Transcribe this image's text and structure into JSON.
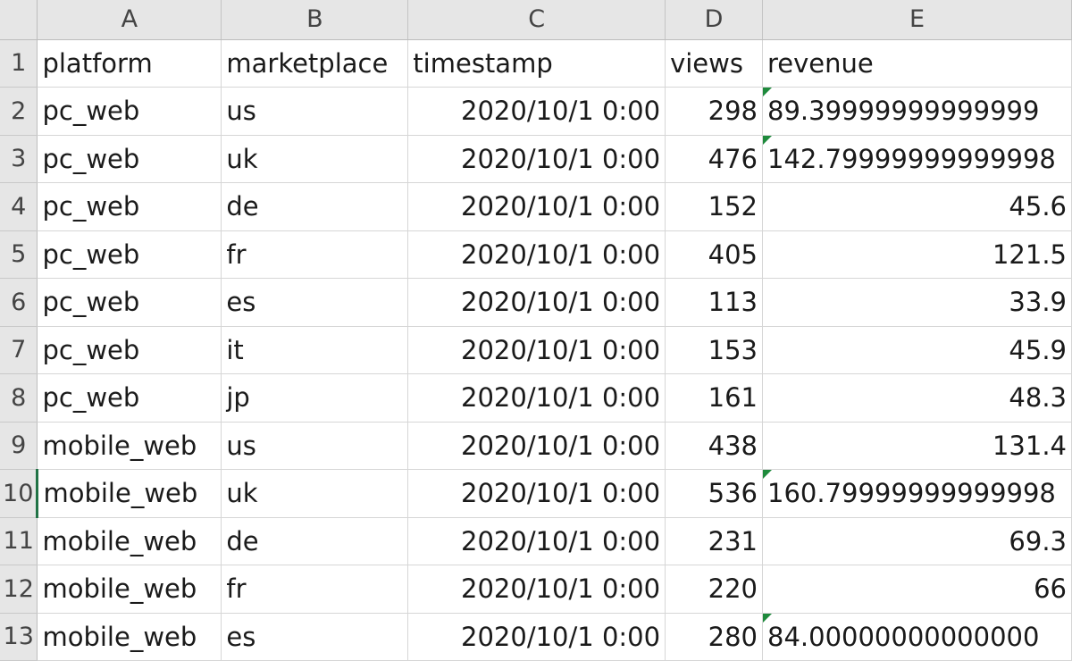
{
  "columns": [
    "A",
    "B",
    "C",
    "D",
    "E"
  ],
  "rows": [
    {
      "n": "1",
      "cells": [
        "platform",
        "marketplace",
        "timestamp",
        "views",
        "revenue"
      ],
      "kind": "header"
    },
    {
      "n": "2",
      "cells": [
        "pc_web",
        "us",
        "2020/10/1 0:00",
        "298",
        "89.39999999999999"
      ],
      "revenue_text": true
    },
    {
      "n": "3",
      "cells": [
        "pc_web",
        "uk",
        "2020/10/1 0:00",
        "476",
        "142.79999999999998"
      ],
      "revenue_text": true
    },
    {
      "n": "4",
      "cells": [
        "pc_web",
        "de",
        "2020/10/1 0:00",
        "152",
        "45.6"
      ]
    },
    {
      "n": "5",
      "cells": [
        "pc_web",
        "fr",
        "2020/10/1 0:00",
        "405",
        "121.5"
      ]
    },
    {
      "n": "6",
      "cells": [
        "pc_web",
        "es",
        "2020/10/1 0:00",
        "113",
        "33.9"
      ]
    },
    {
      "n": "7",
      "cells": [
        "pc_web",
        "it",
        "2020/10/1 0:00",
        "153",
        "45.9"
      ]
    },
    {
      "n": "8",
      "cells": [
        "pc_web",
        "jp",
        "2020/10/1 0:00",
        "161",
        "48.3"
      ]
    },
    {
      "n": "9",
      "cells": [
        "mobile_web",
        "us",
        "2020/10/1 0:00",
        "438",
        "131.4"
      ]
    },
    {
      "n": "10",
      "cells": [
        "mobile_web",
        "uk",
        "2020/10/1 0:00",
        "536",
        "160.79999999999998"
      ],
      "revenue_text": true,
      "active": true
    },
    {
      "n": "11",
      "cells": [
        "mobile_web",
        "de",
        "2020/10/1 0:00",
        "231",
        "69.3"
      ]
    },
    {
      "n": "12",
      "cells": [
        "mobile_web",
        "fr",
        "2020/10/1 0:00",
        "220",
        "66"
      ]
    },
    {
      "n": "13",
      "cells": [
        "mobile_web",
        "es",
        "2020/10/1 0:00",
        "280",
        "84.00000000000000"
      ],
      "revenue_text": true
    }
  ],
  "colors": {
    "error_flag": "#1e8a3c",
    "active_row_marker": "#217346"
  }
}
